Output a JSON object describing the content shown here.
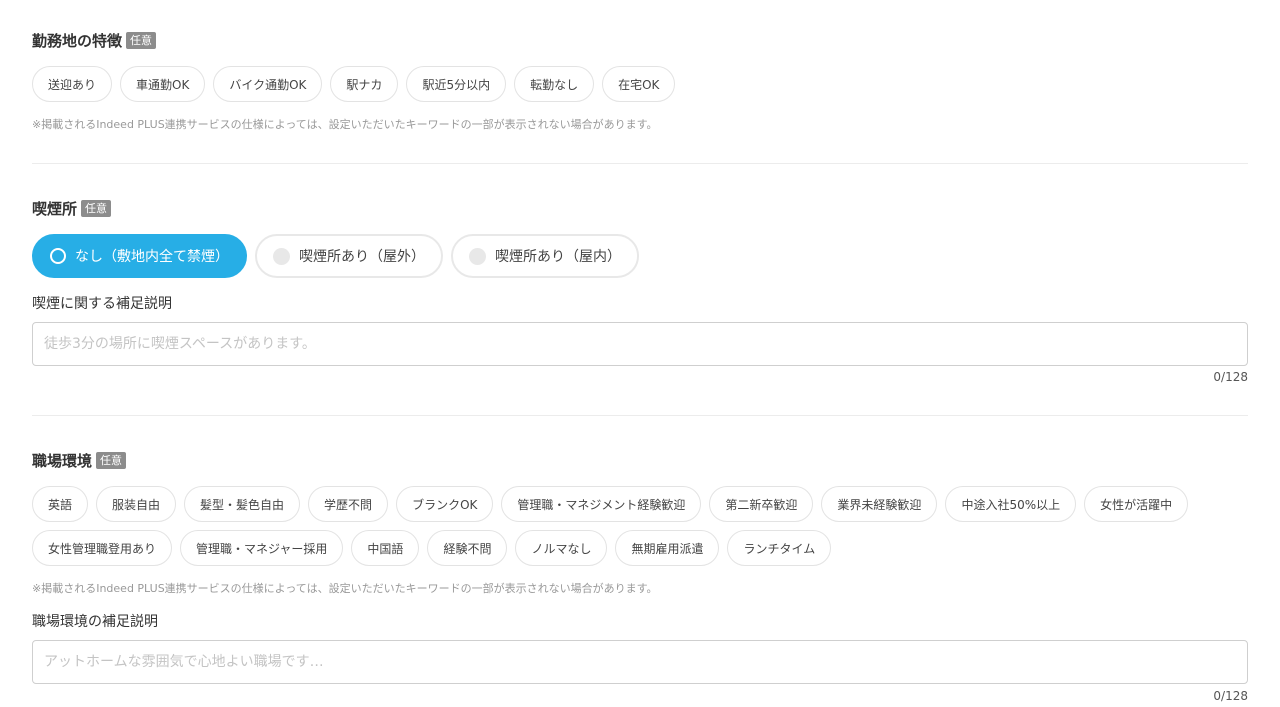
{
  "workplace_features": {
    "title": "勤務地の特徴",
    "badge": "任意",
    "options": [
      "送迎あり",
      "車通勤OK",
      "バイク通勤OK",
      "駅ナカ",
      "駅近5分以内",
      "転勤なし",
      "在宅OK"
    ],
    "note": "※掲載されるIndeed PLUS連携サービスの仕様によっては、設定いただいたキーワードの一部が表示されない場合があります。"
  },
  "smoking": {
    "title": "喫煙所",
    "badge": "任意",
    "options": [
      {
        "label": "なし（敷地内全て禁煙）",
        "selected": true
      },
      {
        "label": "喫煙所あり（屋外）",
        "selected": false
      },
      {
        "label": "喫煙所あり（屋内）",
        "selected": false
      }
    ],
    "description_label": "喫煙に関する補足説明",
    "description_placeholder": "徒歩3分の場所に喫煙スペースがあります。",
    "description_value": "",
    "counter": "0/128"
  },
  "environment": {
    "title": "職場環境",
    "badge": "任意",
    "options_row1": [
      "英語",
      "服装自由",
      "髪型・髪色自由",
      "学歴不問",
      "ブランクOK",
      "管理職・マネジメント経験歓迎",
      "第二新卒歓迎",
      "業界未経験歓迎",
      "中途入社50%以上",
      "女性が活躍中"
    ],
    "options_row2": [
      "女性管理職登用あり",
      "管理職・マネジャー採用",
      "中国語",
      "経験不問",
      "ノルマなし",
      "無期雇用派遣",
      "ランチタイム"
    ],
    "note": "※掲載されるIndeed PLUS連携サービスの仕様によっては、設定いただいたキーワードの一部が表示されない場合があります。",
    "description_label": "職場環境の補足説明",
    "description_placeholder": "アットホームな雰囲気で心地よい職場です…",
    "description_value": "",
    "counter": "0/128"
  },
  "colors": {
    "accent": "#27aee6",
    "badge": "#8c8c8c",
    "chip_border": "#e3e3e3",
    "note_text": "#999999",
    "divider": "#ececec"
  }
}
